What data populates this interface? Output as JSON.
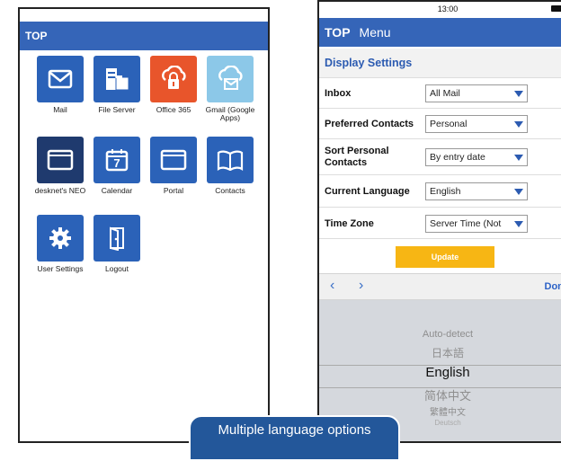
{
  "left": {
    "title": "TOP",
    "apps": [
      {
        "id": "mail",
        "label": "Mail",
        "icon": "envelope-icon",
        "color": "#2b62b8"
      },
      {
        "id": "file-server",
        "label": "File Server",
        "icon": "server-icon",
        "color": "#2b62b8"
      },
      {
        "id": "office365",
        "label": "Office 365",
        "icon": "cloud-lock-icon",
        "color": "#e8552b"
      },
      {
        "id": "gmail",
        "label": "Gmail (Google Apps)",
        "icon": "cloud-mail-icon",
        "color": "#8cc8e8"
      },
      {
        "id": "desknets-neo",
        "label": "desknet's NEO",
        "icon": "window-icon",
        "color": "#1f3a6e"
      },
      {
        "id": "calendar",
        "label": "Calendar",
        "icon": "calendar-icon",
        "color": "#2b62b8",
        "day": "7"
      },
      {
        "id": "portal",
        "label": "Portal",
        "icon": "window-icon",
        "color": "#2b62b8"
      },
      {
        "id": "contacts",
        "label": "Contacts",
        "icon": "book-icon",
        "color": "#2b62b8"
      },
      {
        "id": "user-settings",
        "label": "User Settings",
        "icon": "gear-icon",
        "color": "#2b62b8"
      },
      {
        "id": "logout",
        "label": "Logout",
        "icon": "door-icon",
        "color": "#2b62b8"
      }
    ]
  },
  "right": {
    "status_time": "13:00",
    "topbar_title": "TOP",
    "topbar_menu": "Menu",
    "section_title": "Display Settings",
    "rows": [
      {
        "label": "Inbox",
        "value": "All Mail"
      },
      {
        "label": "Preferred Contacts",
        "value": "Personal"
      },
      {
        "label": "Sort Personal Contacts",
        "value": "By entry date"
      },
      {
        "label": "Current Language",
        "value": "English"
      },
      {
        "label": "Time Zone",
        "value": "Server Time (Not"
      }
    ],
    "update_label": "Update",
    "prev_arrow": "‹",
    "next_arrow": "›",
    "done_label": "Done",
    "picker_options": [
      "Auto-detect",
      "日本語",
      "English",
      "简体中文",
      "繁體中文",
      "Deutsch"
    ],
    "selected_option": "English"
  },
  "callout": "Multiple language options",
  "colors": {
    "accent": "#3565b8",
    "update": "#f7b614",
    "callout": "#23579a"
  }
}
